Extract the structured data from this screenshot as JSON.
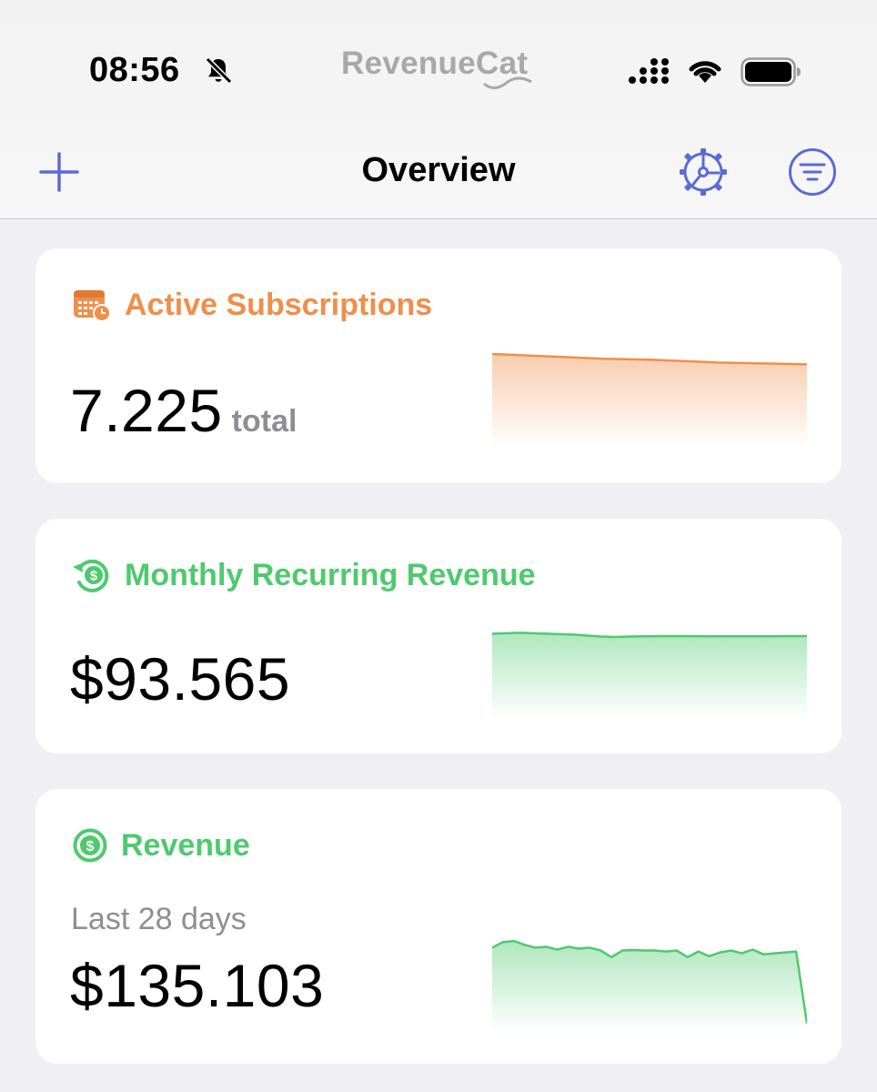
{
  "status_bar": {
    "time": "08:56",
    "brand": "RevenueCat"
  },
  "nav": {
    "title": "Overview"
  },
  "cards": [
    {
      "title": "Active Subscriptions",
      "value": "7.225",
      "unit": "total",
      "color": "#ef8f4b",
      "icon": "calendar-clock-icon",
      "spark": [
        10.0,
        9.9,
        9.8,
        9.7,
        9.6,
        9.5,
        9.45,
        9.4,
        9.3,
        9.2,
        9.1,
        9.05,
        9.0,
        8.95,
        8.9
      ]
    },
    {
      "title": "Monthly Recurring Revenue",
      "value": "$93.565",
      "color": "#4fc96e",
      "icon": "recurring-dollar-icon",
      "spark": [
        9.0,
        9.05,
        9.1,
        9.05,
        9.0,
        8.95,
        8.9,
        8.8,
        8.7,
        8.65,
        8.7,
        8.72,
        8.74,
        8.75,
        8.75,
        8.74,
        8.73,
        8.73,
        8.72,
        8.72,
        8.73,
        8.74,
        8.75,
        8.75
      ]
    },
    {
      "title": "Revenue",
      "subtitle": "Last 28 days",
      "value": "$135.103",
      "color": "#4fc96e",
      "icon": "dollar-circle-icon",
      "spark": [
        9.0,
        9.6,
        9.7,
        9.3,
        9.0,
        9.1,
        8.8,
        9.1,
        8.9,
        9.0,
        8.7,
        8.0,
        8.7,
        8.75,
        8.7,
        8.7,
        8.6,
        8.7,
        8.0,
        8.6,
        8.1,
        8.5,
        8.7,
        8.4,
        8.8,
        8.3,
        8.4,
        8.5,
        8.6,
        1.0
      ]
    }
  ]
}
